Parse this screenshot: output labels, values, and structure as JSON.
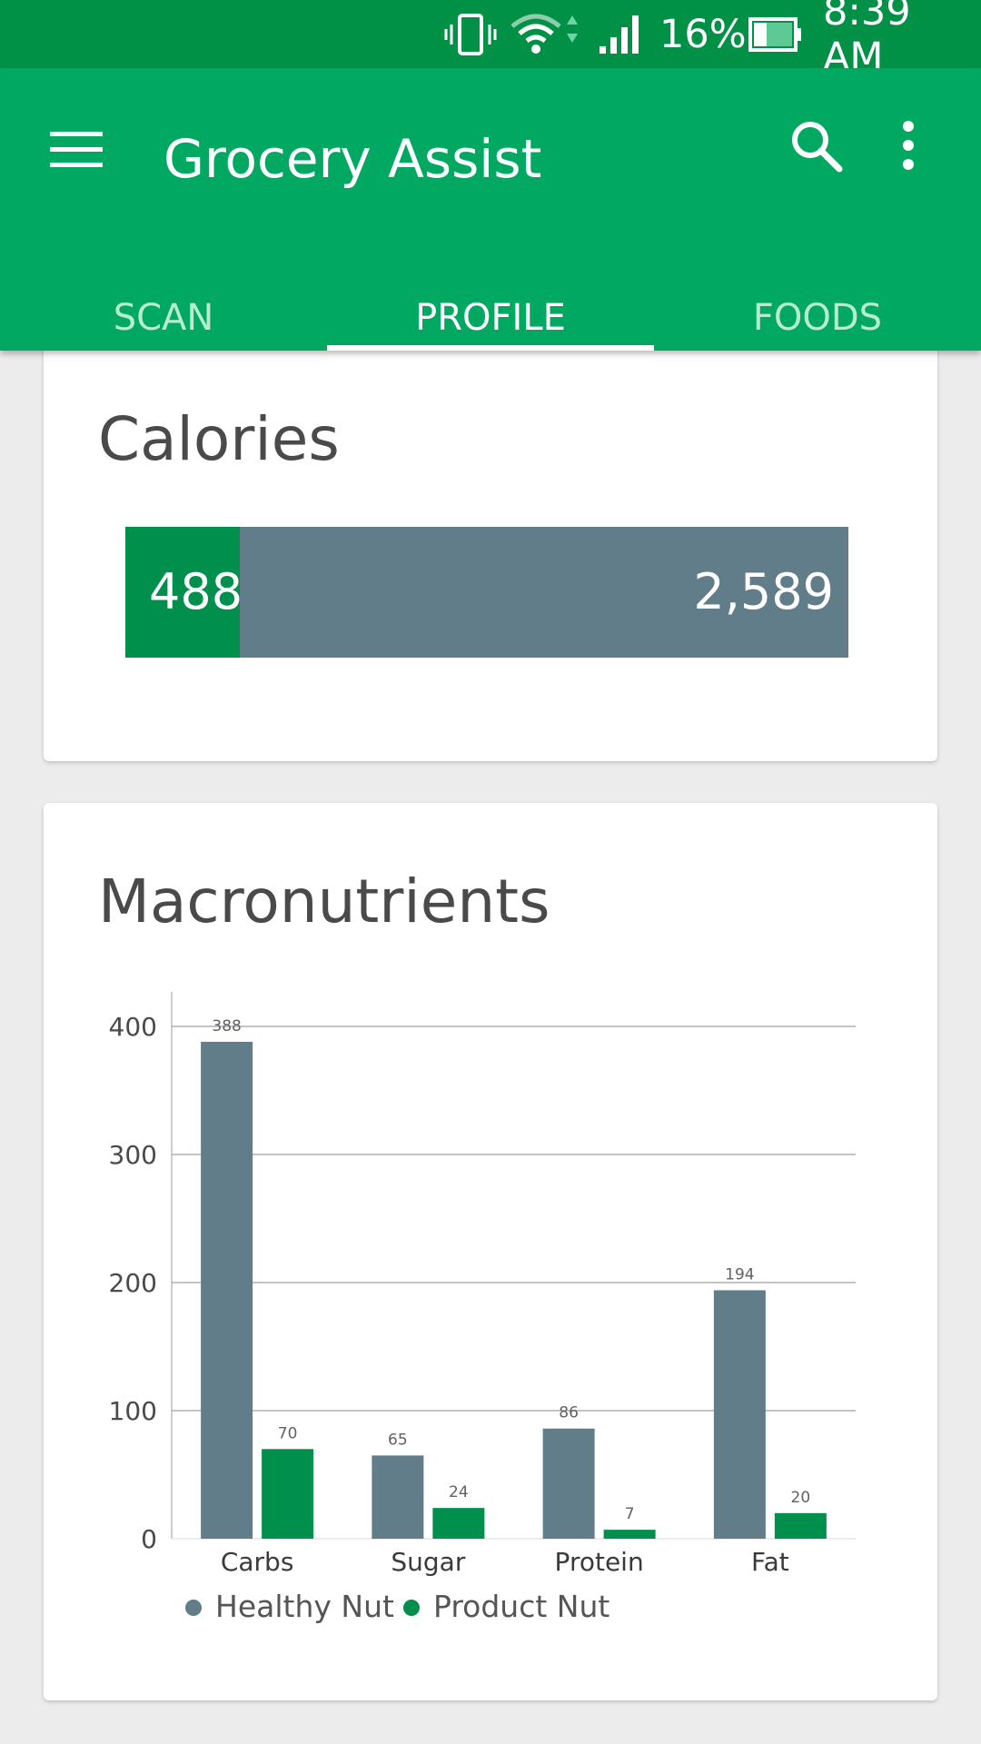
{
  "status_bar": {
    "battery_percent": "16%",
    "time": "8:39 AM",
    "icons": [
      "vibrate-icon",
      "wifi-icon",
      "signal-icon",
      "battery-icon"
    ]
  },
  "app_bar": {
    "title": "Grocery Assist",
    "icons": [
      "menu-icon",
      "search-icon",
      "overflow-menu-icon"
    ]
  },
  "tabs": [
    {
      "label": "SCAN",
      "active": false
    },
    {
      "label": "PROFILE",
      "active": true
    },
    {
      "label": "FOODS",
      "active": false
    }
  ],
  "calories_card": {
    "title": "Calories",
    "consumed": 488,
    "consumed_label": "488",
    "goal": 2589,
    "goal_label": "2,589"
  },
  "macros_card": {
    "title": "Macronutrients"
  },
  "colors": {
    "primary": "#00a862",
    "primary_dark": "#009147",
    "series_healthy": "#627d8a",
    "series_product": "#008f4c"
  },
  "chart_data": {
    "type": "bar",
    "categories": [
      "Carbs",
      "Sugar",
      "Protein",
      "Fat"
    ],
    "series": [
      {
        "name": "Healthy Nut",
        "values": [
          388,
          65,
          86,
          194
        ],
        "color": "#627d8a"
      },
      {
        "name": "Product Nut",
        "values": [
          70,
          24,
          7,
          20
        ],
        "color": "#008f4c"
      }
    ],
    "yticks": [
      0,
      100,
      200,
      300,
      400
    ],
    "ylim": [
      0,
      400
    ],
    "grid": true,
    "legend": "bottom"
  }
}
